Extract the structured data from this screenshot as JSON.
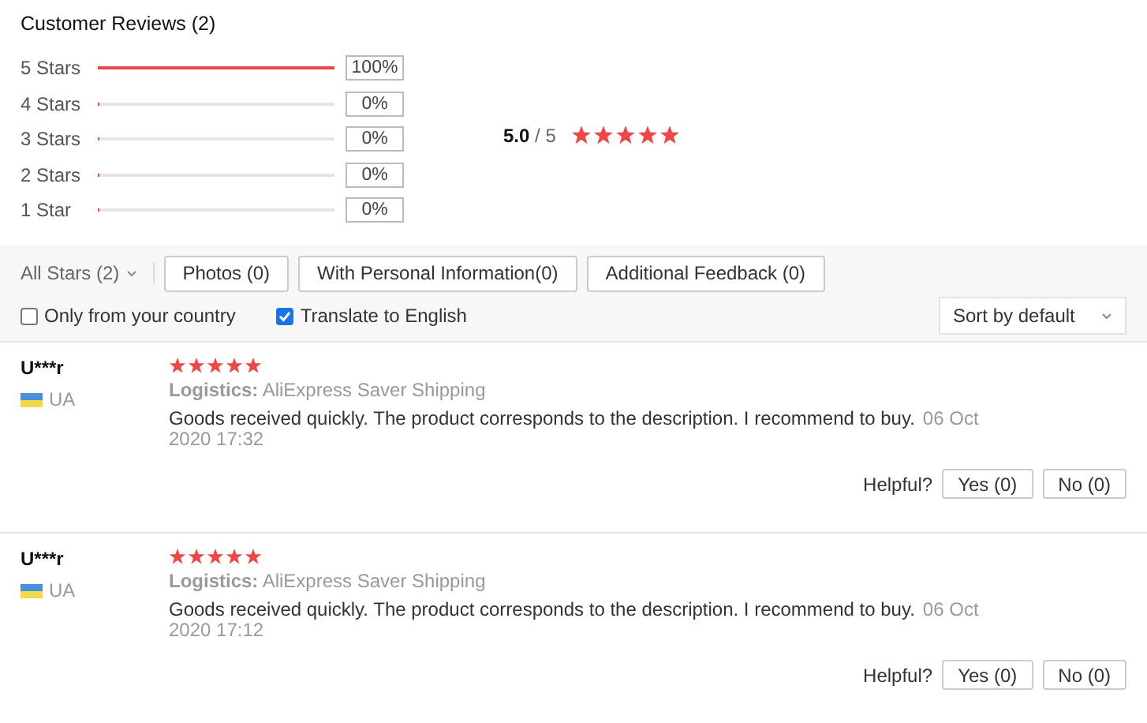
{
  "title": "Customer Reviews (2)",
  "breakdown": [
    {
      "label": "5 Stars",
      "level": 1,
      "percent": "100%"
    },
    {
      "label": "4 Stars",
      "level": 0,
      "percent": "0%"
    },
    {
      "label": "3 Stars",
      "level": 0,
      "percent": "0%"
    },
    {
      "label": "2 Stars",
      "level": 0,
      "percent": "0%"
    },
    {
      "label": "1 Star",
      "level": 0,
      "percent": "0%"
    }
  ],
  "average": {
    "score": "5.0",
    "out_of": "/ 5",
    "stars": 5
  },
  "filters": {
    "star_filter": "All Stars (2)",
    "buttons": [
      "Photos (0)",
      "With Personal Information(0)",
      "Additional Feedback (0)"
    ],
    "checkboxes": [
      {
        "label": "Only from your country",
        "checked": false
      },
      {
        "label": "Translate to English",
        "checked": true
      }
    ],
    "sort": "Sort by default"
  },
  "reviews": [
    {
      "user": "U***r",
      "country": "UA",
      "stars": 5,
      "logistics_label": "Logistics:",
      "logistics": "AliExpress Saver Shipping",
      "text": "Goods received quickly. The product corresponds to the description. I recommend to buy.",
      "date": "06 Oct 2020 17:32",
      "helpful": "Helpful?",
      "yes": "Yes (0)",
      "no": "No (0)"
    },
    {
      "user": "U***r",
      "country": "UA",
      "stars": 5,
      "logistics_label": "Logistics:",
      "logistics": "AliExpress Saver Shipping",
      "text": "Goods received quickly. The product corresponds to the description. I recommend to buy.",
      "date": "06 Oct 2020 17:12",
      "helpful": "Helpful?",
      "yes": "Yes (0)",
      "no": "No (0)"
    }
  ]
}
